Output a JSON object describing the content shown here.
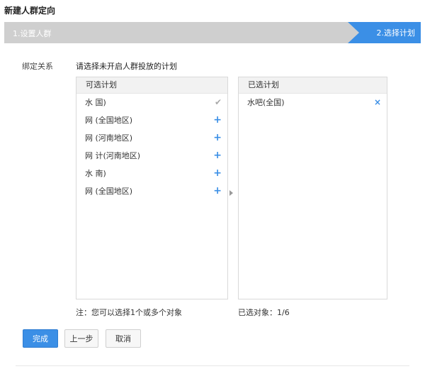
{
  "page": {
    "title": "新建人群定向"
  },
  "steps": [
    {
      "label": "1.设置人群"
    },
    {
      "label": "2.选择计划"
    }
  ],
  "binding": {
    "label": "绑定关系",
    "instruction": "请选择未开启人群投放的计划"
  },
  "available_panel": {
    "header": "可选计划",
    "items": [
      {
        "label": "水 国)",
        "action": "check-icon"
      },
      {
        "label": "网 (全国地区)",
        "action": "plus-icon"
      },
      {
        "label": "网 (河南地区)",
        "action": "plus-icon"
      },
      {
        "label": "网 计(河南地区)",
        "action": "plus-icon"
      },
      {
        "label": "水 南)",
        "action": "plus-icon"
      },
      {
        "label": "网 (全国地区)",
        "action": "plus-icon"
      }
    ]
  },
  "selected_panel": {
    "header": "已选计划",
    "items": [
      {
        "label": "水吧(全国)",
        "action": "close-icon"
      }
    ]
  },
  "notes": {
    "left": "注：您可以选择1个或多个对象",
    "right": "已选对象：1/6"
  },
  "buttons": {
    "finish": "完成",
    "prev": "上一步",
    "cancel": "取消"
  },
  "icons": {
    "check": "✔",
    "plus": "+",
    "close": "×"
  },
  "colors": {
    "accent": "#3b8fe6",
    "step_bar": "#cfcfcf"
  }
}
